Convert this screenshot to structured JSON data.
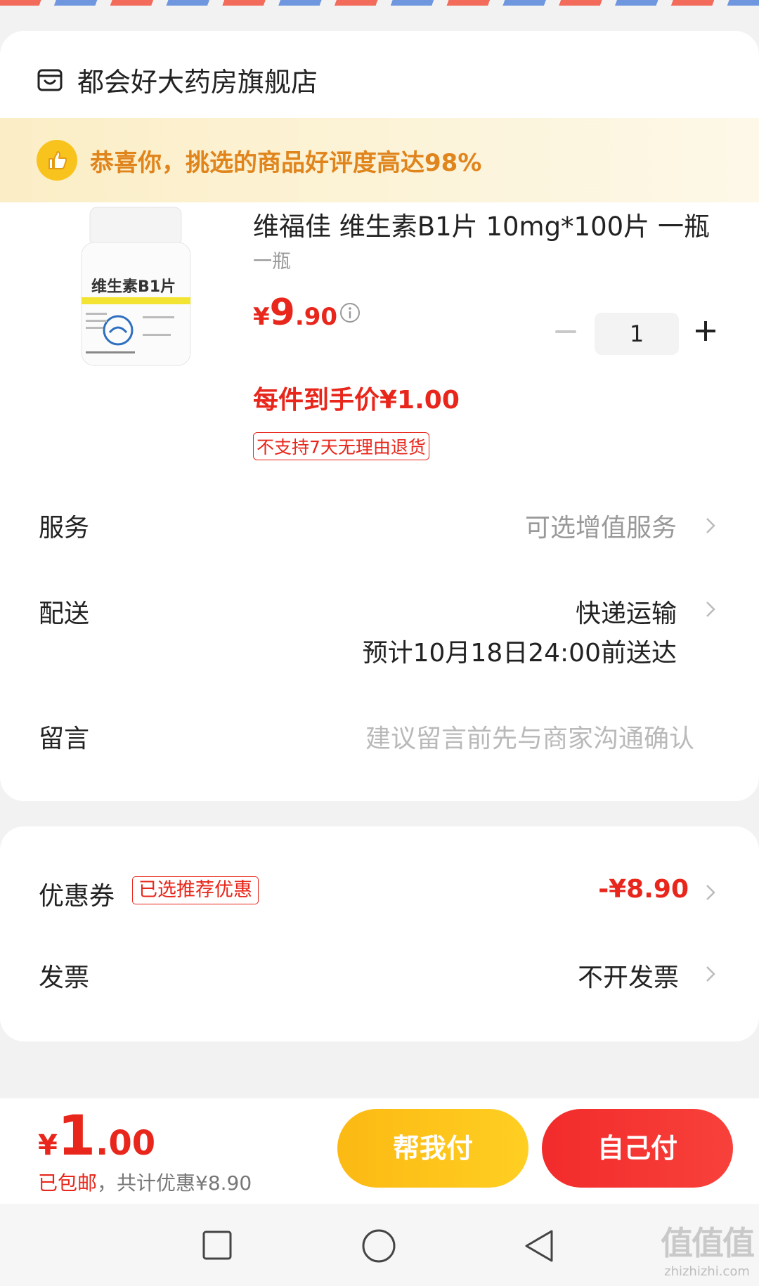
{
  "shop": {
    "name": "都会好大药房旗舰店",
    "icon": "shop-icon"
  },
  "praise": {
    "text": "恭喜你，挑选的商品好评度高达98%",
    "icon": "thumbs-up-icon"
  },
  "product": {
    "title": "维福佳 维生素B1片 10mg*100片 一瓶",
    "spec": "一瓶",
    "price_currency": "¥",
    "price_int": "9",
    "price_dec": ".90",
    "hand_price": "每件到手价¥1.00",
    "no_return_tag": "不支持7天无理由退货",
    "quantity": "1",
    "bottle_label": "维生素B1片"
  },
  "rows": {
    "service_label": "服务",
    "service_value": "可选增值服务",
    "delivery_label": "配送",
    "delivery_value": "快递运输",
    "delivery_eta": "预计10月18日24:00前送达",
    "message_label": "留言",
    "message_placeholder": "建议留言前先与商家沟通确认"
  },
  "coupon": {
    "label": "优惠券",
    "badge": "已选推荐优惠",
    "value": "-¥8.90"
  },
  "invoice": {
    "label": "发票",
    "value": "不开发票"
  },
  "footer": {
    "currency": "¥",
    "total_int": "1",
    "total_dec": ".00",
    "shipping": "已包邮",
    "discount": "，共计优惠¥8.90",
    "help_pay": "帮我付",
    "self_pay": "自己付"
  },
  "watermark": {
    "big": "值值值",
    "small": "zhizhizhi.com"
  },
  "colors": {
    "accent_red": "#e8261b",
    "praise_orange": "#e0841c",
    "help_btn": "#fcb913",
    "self_btn": "#f22b2b"
  }
}
